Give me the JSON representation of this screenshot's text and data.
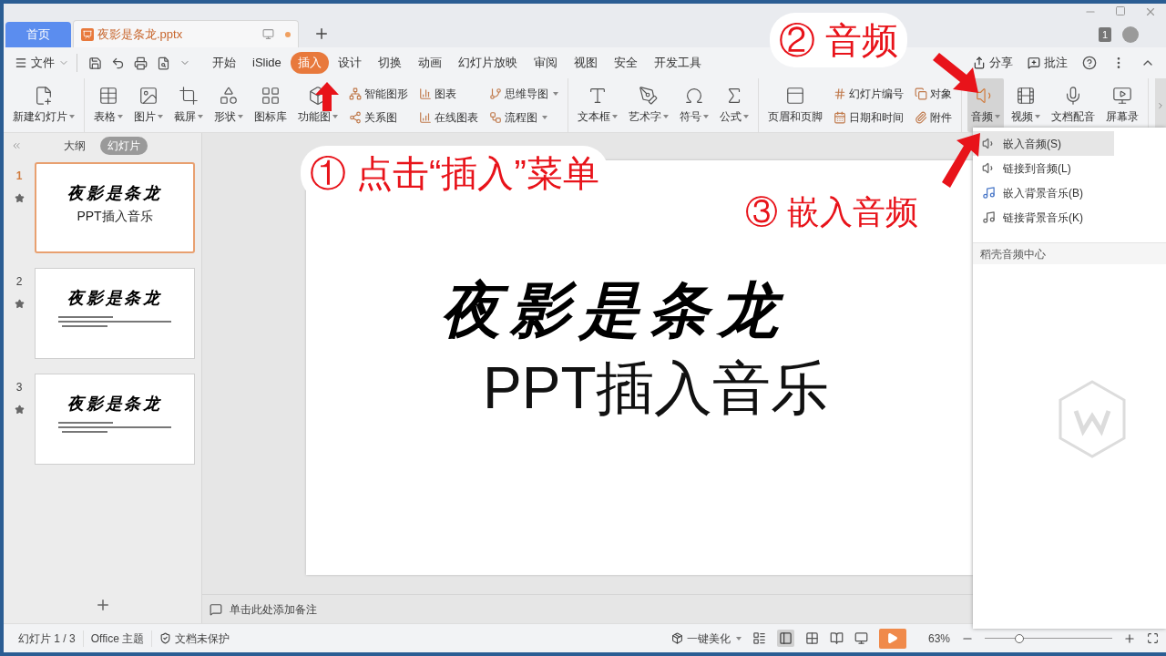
{
  "title_bar": {
    "tabs": [
      {
        "label": "首页",
        "selected": false,
        "kind": "home"
      },
      {
        "label": "夜影是条龙.pptx",
        "selected": true,
        "kind": "document",
        "unsaved": true
      }
    ],
    "badge": "1"
  },
  "menu": {
    "file": "文件",
    "items": [
      {
        "label": "开始",
        "selected": false
      },
      {
        "label": "iSlide",
        "selected": false
      },
      {
        "label": "插入",
        "selected": true
      },
      {
        "label": "设计",
        "selected": false
      },
      {
        "label": "切换",
        "selected": false
      },
      {
        "label": "动画",
        "selected": false
      },
      {
        "label": "幻灯片放映",
        "selected": false
      },
      {
        "label": "审阅",
        "selected": false
      },
      {
        "label": "视图",
        "selected": false
      },
      {
        "label": "安全",
        "selected": false
      },
      {
        "label": "开发工具",
        "selected": false
      }
    ],
    "right": [
      "分享",
      "批注"
    ]
  },
  "ribbon": [
    {
      "items": [
        {
          "kind": "large",
          "label": "新建幻灯片",
          "dropdown": true,
          "selected": false
        }
      ]
    },
    {
      "items": [
        {
          "kind": "large",
          "label": "表格",
          "dropdown": true,
          "selected": false
        },
        {
          "kind": "large",
          "label": "图片",
          "dropdown": true,
          "selected": false
        },
        {
          "kind": "large",
          "label": "截屏",
          "dropdown": true,
          "selected": false
        },
        {
          "kind": "large",
          "label": "形状",
          "dropdown": true,
          "selected": false
        },
        {
          "kind": "large",
          "label": "图标库",
          "dropdown": false,
          "selected": false
        },
        {
          "kind": "large",
          "label": "功能图",
          "dropdown": true,
          "selected": false
        },
        {
          "kind": "column",
          "children": [
            {
              "label": "智能图形",
              "dropdown": false
            },
            {
              "label": "关系图",
              "dropdown": false
            }
          ]
        },
        {
          "kind": "column",
          "children": [
            {
              "label": "图表",
              "dropdown": false
            },
            {
              "label": "在线图表",
              "dropdown": false
            }
          ]
        },
        {
          "kind": "column",
          "children": [
            {
              "label": "思维导图",
              "dropdown": true
            },
            {
              "label": "流程图",
              "dropdown": true
            }
          ]
        }
      ]
    },
    {
      "items": [
        {
          "kind": "large",
          "label": "文本框",
          "dropdown": true,
          "selected": false
        },
        {
          "kind": "large",
          "label": "艺术字",
          "dropdown": true,
          "selected": false
        },
        {
          "kind": "large",
          "label": "符号",
          "dropdown": true,
          "selected": false
        },
        {
          "kind": "large",
          "label": "公式",
          "dropdown": true,
          "selected": false
        }
      ]
    },
    {
      "items": [
        {
          "kind": "large",
          "label": "页眉和页脚",
          "dropdown": false,
          "selected": false
        },
        {
          "kind": "column",
          "children": [
            {
              "label": "幻灯片编号",
              "dropdown": false
            },
            {
              "label": "日期和时间",
              "dropdown": false
            }
          ]
        },
        {
          "kind": "column",
          "children": [
            {
              "label": "对象",
              "dropdown": false
            },
            {
              "label": "附件",
              "dropdown": false
            }
          ]
        }
      ]
    },
    {
      "items": [
        {
          "kind": "large",
          "label": "音频",
          "dropdown": true,
          "selected": true
        },
        {
          "kind": "large",
          "label": "视频",
          "dropdown": true,
          "selected": false
        },
        {
          "kind": "large",
          "label": "文档配音",
          "dropdown": false,
          "selected": false
        },
        {
          "kind": "large",
          "label": "屏幕录",
          "dropdown": false,
          "selected": false
        }
      ]
    }
  ],
  "slides_panel": {
    "tabs": [
      {
        "label": "大纲",
        "selected": false
      },
      {
        "label": "幻灯片",
        "selected": true
      }
    ],
    "slides": [
      {
        "number": "1",
        "selected": true,
        "kind": "title",
        "title": "夜影是条龙",
        "subtitle": "PPT插入音乐"
      },
      {
        "number": "2",
        "selected": false,
        "kind": "content",
        "title": "夜影是条龙"
      },
      {
        "number": "3",
        "selected": false,
        "kind": "content",
        "title": "夜影是条龙"
      }
    ]
  },
  "slide": {
    "title": "夜影是条龙",
    "subtitle": "PPT插入音乐"
  },
  "notes_placeholder": "单击此处添加备注",
  "audio_menu": {
    "items": [
      {
        "label": "嵌入音频(S)",
        "selected": true
      },
      {
        "label": "链接到音频(L)",
        "selected": false
      },
      {
        "label": "嵌入背景音乐(B)",
        "selected": false
      },
      {
        "label": "链接背景音乐(K)",
        "selected": false
      }
    ],
    "section": "稻壳音频中心"
  },
  "annotations": [
    {
      "text": "① 点击“插入”菜单"
    },
    {
      "text": "② 音频"
    },
    {
      "text": "③ 嵌入音频"
    }
  ],
  "status_bar": {
    "slide": "幻灯片 1 / 3",
    "theme": "Office 主题",
    "protection": "文档未保护",
    "beautify": "一键美化",
    "zoom": "63%",
    "level": 0.27
  }
}
